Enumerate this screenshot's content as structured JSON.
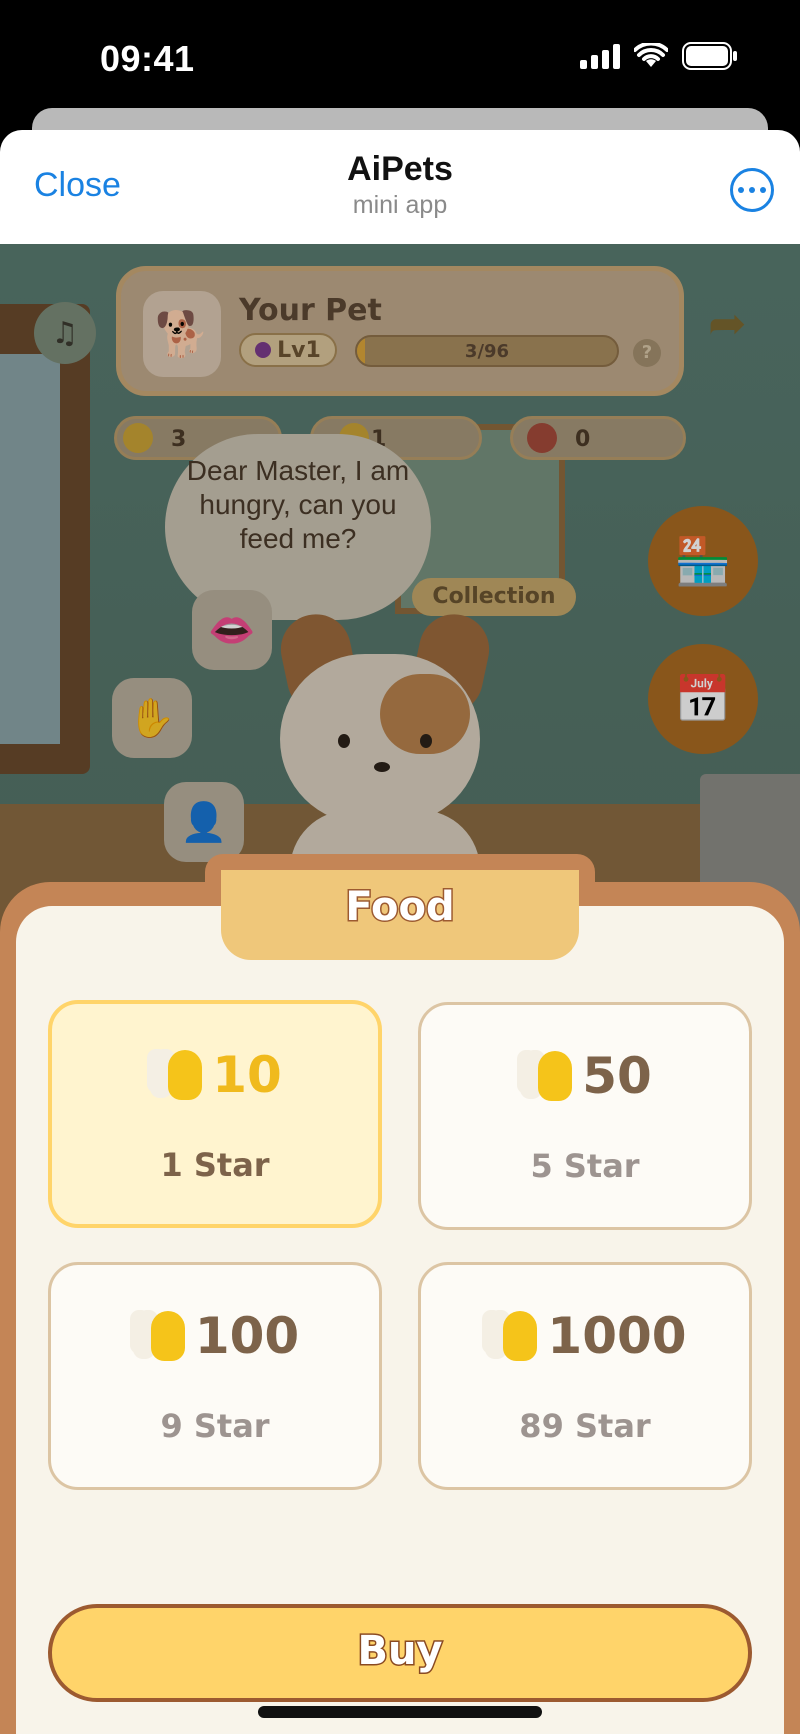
{
  "status_bar": {
    "time": "09:41"
  },
  "header": {
    "close_label": "Close",
    "title": "AiPets",
    "subtitle": "mini app"
  },
  "game": {
    "pet_name": "Your Pet",
    "level": "Lv1",
    "xp_text": "3/96",
    "xp_progress": 0.03,
    "help_label": "?",
    "resources": {
      "coins": "3",
      "food": "1",
      "gifts": "0"
    },
    "speech": "Dear Master, I am hungry, can you feed me?",
    "collection_label": "Collection"
  },
  "food_panel": {
    "title": "Food",
    "options": [
      {
        "amount": "10",
        "price": "1 Star",
        "selected": true
      },
      {
        "amount": "50",
        "price": "5 Star",
        "selected": false
      },
      {
        "amount": "100",
        "price": "9 Star",
        "selected": false
      },
      {
        "amount": "1000",
        "price": "89 Star",
        "selected": false
      }
    ],
    "buy_label": "Buy"
  },
  "colors": {
    "accent_blue": "#1a82e2",
    "panel_brown": "#c48556",
    "selected_yellow": "#ffd46a",
    "amount_gold": "#f0ba1d"
  },
  "icons": {
    "music": "music-note-icon",
    "share": "share-arrow-icon",
    "shop": "shop-icon",
    "calendar": "calendar-icon",
    "kiss": "lips-icon",
    "pet": "hand-icon",
    "person": "person-icon",
    "food": "bone-fish-icon"
  }
}
